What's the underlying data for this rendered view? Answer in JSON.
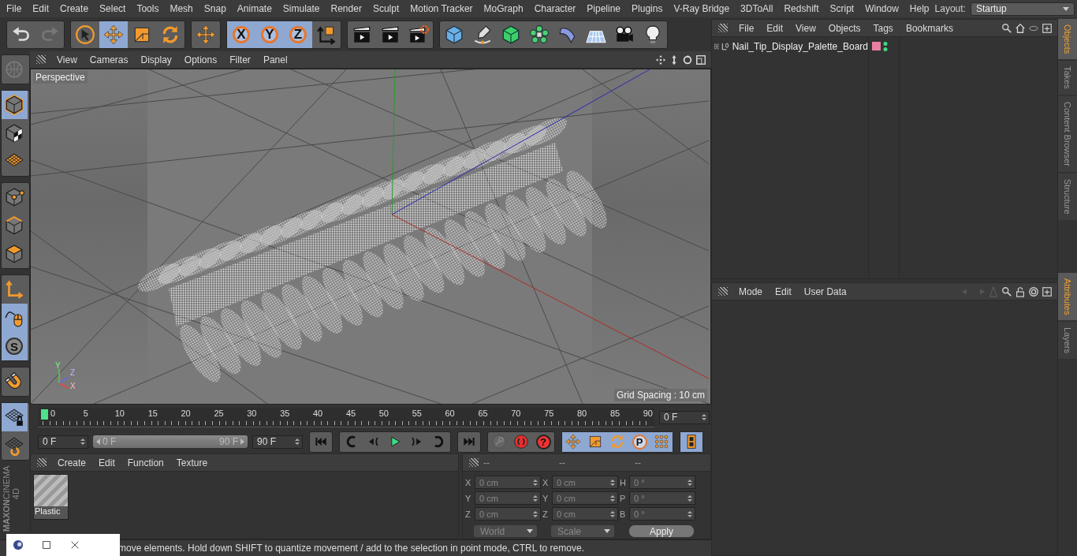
{
  "menu_bar": {
    "items": [
      "File",
      "Edit",
      "Create",
      "Select",
      "Tools",
      "Mesh",
      "Snap",
      "Animate",
      "Simulate",
      "Render",
      "Sculpt",
      "Motion Tracker",
      "MoGraph",
      "Character",
      "Pipeline",
      "Plugins",
      "V-Ray Bridge",
      "3DToAll",
      "Redshift",
      "Script",
      "Window",
      "Help"
    ],
    "layout_label": "Layout:",
    "layout_value": "Startup"
  },
  "top_toolbar": [
    [
      {
        "kind": "undo",
        "selected": false,
        "disabled": false
      },
      {
        "kind": "redo",
        "selected": false,
        "disabled": true
      }
    ],
    [
      {
        "kind": "select",
        "selected": false,
        "disabled": false
      },
      {
        "kind": "move",
        "selected": true,
        "disabled": false
      },
      {
        "kind": "scale",
        "selected": false,
        "disabled": false
      },
      {
        "kind": "rotate",
        "selected": false,
        "disabled": false
      }
    ],
    [
      {
        "kind": "move",
        "selected": false,
        "disabled": false
      }
    ],
    [
      {
        "kind": "axis",
        "label": "X",
        "selected": true,
        "disabled": false
      },
      {
        "kind": "axis",
        "label": "Y",
        "selected": true,
        "disabled": false
      },
      {
        "kind": "axis",
        "label": "Z",
        "selected": true,
        "disabled": false
      },
      {
        "kind": "coords",
        "selected": false,
        "disabled": false
      }
    ],
    [
      {
        "kind": "render",
        "selected": false,
        "disabled": false
      },
      {
        "kind": "render",
        "selected": false,
        "disabled": false
      },
      {
        "kind": "render_settings",
        "selected": false,
        "disabled": false
      }
    ],
    [
      {
        "kind": "cube",
        "selected": false,
        "disabled": false
      },
      {
        "kind": "pen",
        "selected": false,
        "disabled": false
      },
      {
        "kind": "subdiv",
        "selected": false,
        "disabled": false
      },
      {
        "kind": "cloner",
        "selected": false,
        "disabled": false
      },
      {
        "kind": "bend",
        "selected": false,
        "disabled": false
      },
      {
        "kind": "floor",
        "selected": false,
        "disabled": false
      },
      {
        "kind": "camera",
        "selected": false,
        "disabled": false
      },
      {
        "kind": "light",
        "selected": false,
        "disabled": false
      }
    ]
  ],
  "left_toolbar": [
    [
      {
        "kind": "globe",
        "selected": false,
        "disabled": true
      }
    ],
    [
      {
        "kind": "model",
        "selected": true,
        "disabled": false
      },
      {
        "kind": "texture",
        "selected": false,
        "disabled": false
      },
      {
        "kind": "workplane",
        "selected": false,
        "disabled": false
      }
    ],
    [
      {
        "kind": "points",
        "selected": false,
        "disabled": false
      },
      {
        "kind": "edges",
        "selected": false,
        "disabled": false
      },
      {
        "kind": "polygons",
        "selected": false,
        "disabled": false
      }
    ],
    [
      {
        "kind": "axis_mode",
        "selected": false,
        "disabled": false
      },
      {
        "kind": "tweak",
        "selected": true,
        "disabled": false
      },
      {
        "kind": "snap",
        "label": "S",
        "selected": true,
        "disabled": false
      }
    ],
    [
      {
        "kind": "magnet",
        "selected": false,
        "disabled": false
      }
    ],
    [
      {
        "kind": "wp_lock",
        "selected": true,
        "disabled": false
      },
      {
        "kind": "wp_rotate",
        "selected": false,
        "disabled": false
      }
    ]
  ],
  "logo": {
    "brand": "MAXON",
    "product": "CINEMA 4D"
  },
  "viewport": {
    "menu": [
      "View",
      "Cameras",
      "Display",
      "Options",
      "Filter",
      "Panel"
    ],
    "camera_label": "Perspective",
    "grid_spacing": "Grid Spacing : 10 cm",
    "gizmo_labels": [
      "Y",
      "Z",
      "X"
    ]
  },
  "timeline": {
    "labels": [
      "0",
      "5",
      "10",
      "15",
      "20",
      "25",
      "30",
      "35",
      "40",
      "45",
      "50",
      "55",
      "60",
      "65",
      "70",
      "75",
      "80",
      "85",
      "90"
    ],
    "playhead": {
      "level": 0
    },
    "current_frame": "0 F"
  },
  "playback": {
    "start_field": "0 F",
    "range_start": "0 F",
    "range_end": "90 F",
    "range_slider": {
      "level": 1
    },
    "end_field": "90 F",
    "groups": [
      [
        {
          "kind": "first",
          "selected": false,
          "disabled": false
        }
      ],
      [
        {
          "kind": "prev_key",
          "selected": false,
          "disabled": false
        },
        {
          "kind": "prev_frame",
          "selected": false,
          "disabled": false
        },
        {
          "kind": "play",
          "selected": false,
          "disabled": false
        },
        {
          "kind": "next_frame",
          "selected": false,
          "disabled": false
        },
        {
          "kind": "next_key",
          "selected": false,
          "disabled": false
        }
      ],
      [
        {
          "kind": "last",
          "selected": false,
          "disabled": false
        }
      ],
      [
        {
          "kind": "record",
          "selected": false,
          "disabled": true
        },
        {
          "kind": "autokey",
          "selected": false,
          "disabled": false
        },
        {
          "kind": "help",
          "label": "?",
          "selected": false,
          "disabled": false
        }
      ],
      [
        {
          "kind": "move",
          "selected": true,
          "disabled": false
        },
        {
          "kind": "scale",
          "selected": true,
          "disabled": false
        },
        {
          "kind": "rotate",
          "selected": true,
          "disabled": false
        },
        {
          "kind": "param",
          "label": "P",
          "selected": true,
          "disabled": false
        },
        {
          "kind": "pla",
          "selected": true,
          "disabled": false
        }
      ],
      [
        {
          "kind": "film",
          "selected": true,
          "disabled": false
        }
      ]
    ]
  },
  "materials": {
    "menu": [
      "Create",
      "Edit",
      "Function",
      "Texture"
    ],
    "items": [
      {
        "name": "Plastic"
      }
    ]
  },
  "coordinates": {
    "headers": [
      "--",
      "--",
      "--"
    ],
    "columns": [
      [
        {
          "label": "X",
          "value": "0 cm",
          "disabled": true
        },
        {
          "label": "Y",
          "value": "0 cm",
          "disabled": true
        },
        {
          "label": "Z",
          "value": "0 cm",
          "disabled": true
        }
      ],
      [
        {
          "label": "X",
          "value": "0 cm",
          "disabled": true
        },
        {
          "label": "Y",
          "value": "0 cm",
          "disabled": true
        },
        {
          "label": "Z",
          "value": "0 cm",
          "disabled": true
        }
      ],
      [
        {
          "label": "H",
          "value": "0 °",
          "disabled": true
        },
        {
          "label": "P",
          "value": "0 °",
          "disabled": true
        },
        {
          "label": "B",
          "value": "0 °",
          "disabled": true
        }
      ]
    ],
    "dropdowns": [
      {
        "value": "World",
        "disabled": true
      },
      {
        "value": "Scale",
        "disabled": true
      }
    ],
    "apply": "Apply"
  },
  "status_bar": {
    "text": "move elements. Hold down SHIFT to quantize movement / add to the selection in point mode, CTRL to remove."
  },
  "objects_manager": {
    "menu": [
      "File",
      "Edit",
      "View",
      "Objects",
      "Tags",
      "Bookmarks"
    ],
    "objects": [
      {
        "name": "Nail_Tip_Display_Palette_Board",
        "expanded": false,
        "color": "#e87fa3"
      }
    ]
  },
  "attributes_manager": {
    "menu": [
      "Mode",
      "Edit",
      "User Data"
    ]
  },
  "side_tabs_top": [
    {
      "label": "Objects",
      "selected": true
    },
    {
      "label": "Takes",
      "selected": false
    },
    {
      "label": "Content Browser",
      "selected": false
    },
    {
      "label": "Structure",
      "selected": false
    }
  ],
  "side_tabs_bottom": [
    {
      "label": "Attributes",
      "selected": true
    },
    {
      "label": "Layers",
      "selected": false
    }
  ]
}
